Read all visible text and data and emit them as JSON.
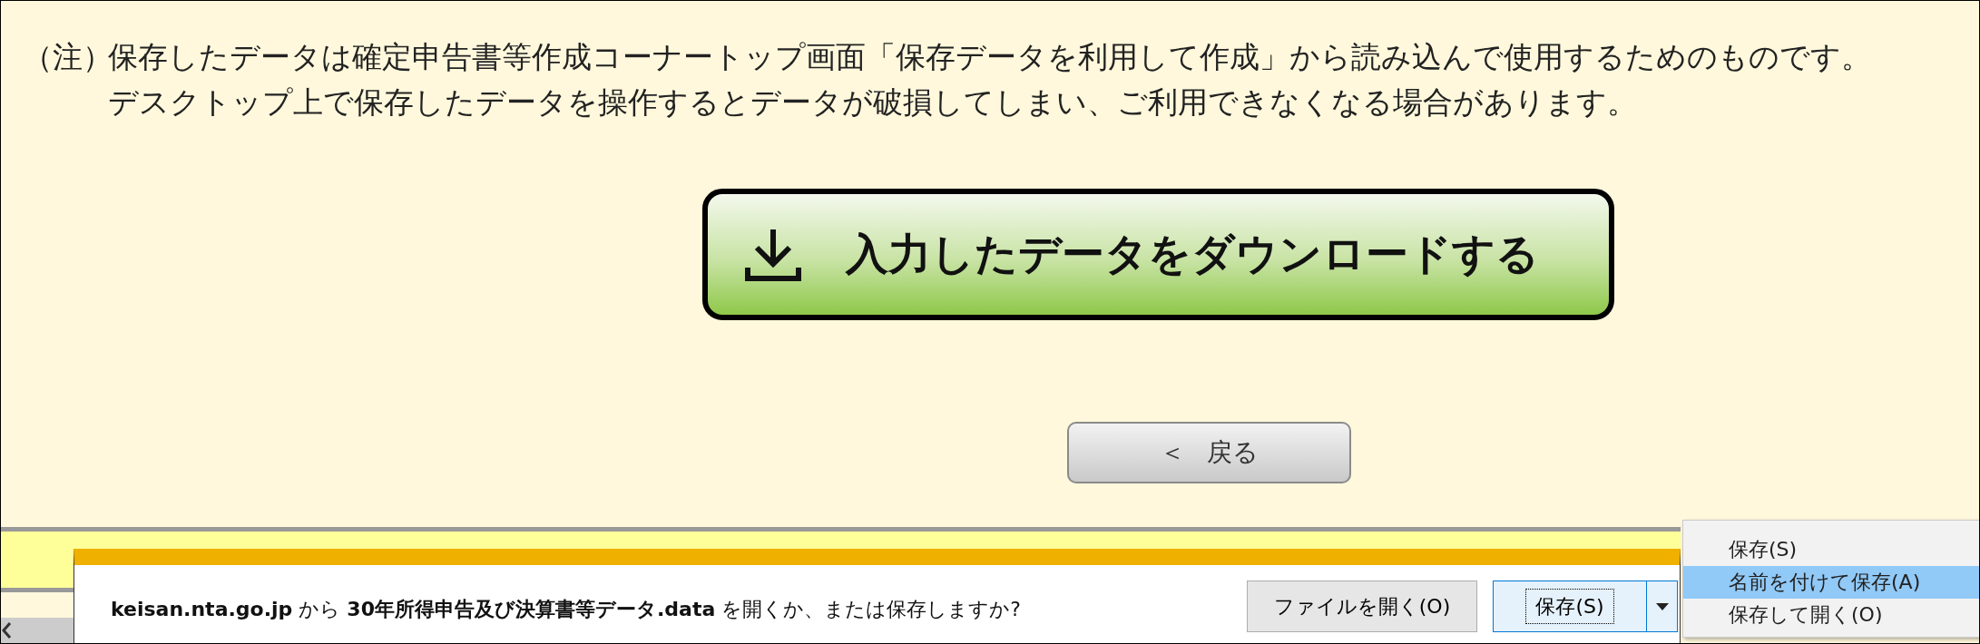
{
  "note": {
    "label": "（注）",
    "lines": [
      "保存したデータは確定申告書等作成コーナートップ画面「保存データを利用して作成」から読み込んで使用するためのものです。",
      "デスクトップ上で保存したデータを操作するとデータが破損してしまい、ご利用できなくなる場合があります。"
    ]
  },
  "download_button": {
    "label": "入力したデータをダウンロードする"
  },
  "back_button": {
    "arrow": "＜",
    "label": "戻る"
  },
  "notification": {
    "message": "**keisan.nta.go.jp** から **30年所得申告及び決算書等データ.data** を開くか、または保存しますか?",
    "open_button": "ファイルを開く(O)",
    "save_button": "保存(S)"
  },
  "save_menu": [
    {
      "label": "保存(S)",
      "selected": false
    },
    {
      "label": "名前を付けて保存(A)",
      "selected": true
    },
    {
      "label": "保存して開く(O)",
      "selected": false
    }
  ]
}
